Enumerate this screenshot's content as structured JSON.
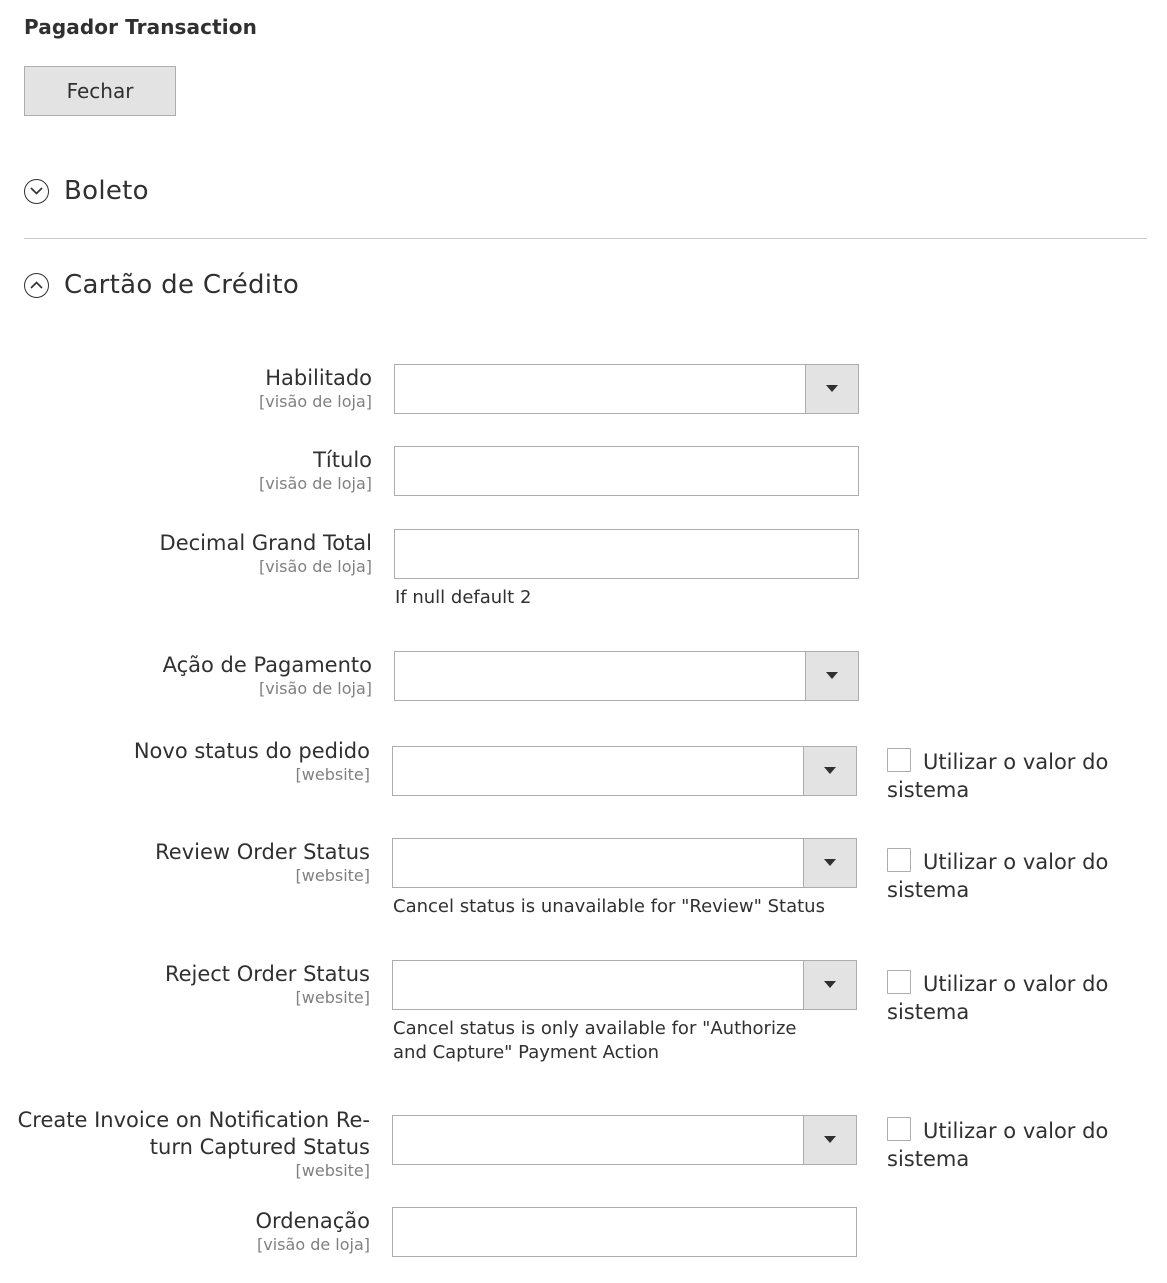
{
  "header": {
    "title": "Pagador Transaction",
    "close_label": "Fechar"
  },
  "sections": {
    "boleto": {
      "title": "Boleto",
      "state": "collapsed"
    },
    "cartao": {
      "title": "Cartão de Crédito",
      "state": "expanded"
    }
  },
  "use_system_label": "Utilizar o valor do sistema",
  "fields": [
    {
      "label": "Habilitado",
      "scope": "[visão de loja]",
      "type": "select",
      "value": ""
    },
    {
      "label": "Título",
      "scope": "[visão de loja]",
      "type": "text",
      "value": ""
    },
    {
      "label": "Decimal Grand Total",
      "scope": "[visão de loja]",
      "type": "text",
      "value": "",
      "note": "If null default 2"
    },
    {
      "label": "Ação de Pagamento",
      "scope": "[visão de loja]",
      "type": "select",
      "value": ""
    },
    {
      "label": "Novo status do pedido",
      "scope": "[website]",
      "type": "select",
      "value": "",
      "use_system": false
    },
    {
      "label": "Review Order Status",
      "scope": "[website]",
      "type": "select",
      "value": "",
      "use_system": false,
      "note": "Cancel status is unavailable for \"Review\" Status"
    },
    {
      "label": "Reject Order Status",
      "scope": "[website]",
      "type": "select",
      "value": "",
      "use_system": false,
      "note": "Cancel status is only available for \"Authorize and Capture\" Payment Action"
    },
    {
      "label_line1": "Create Invoice on Notification Re-",
      "label_line2": "turn Captured Status",
      "scope": "[website]",
      "type": "select",
      "value": "",
      "use_system": false
    },
    {
      "label": "Ordenação",
      "scope": "[visão de loja]",
      "type": "text",
      "value": ""
    }
  ],
  "icons": {
    "collapsed": "chevron-down-circle-icon",
    "expanded": "chevron-up-circle-icon",
    "select_arrow": "caret-down-icon"
  },
  "colors": {
    "text": "#303030",
    "muted": "#808080",
    "border": "#adadad",
    "button_bg": "#e3e3e3"
  }
}
